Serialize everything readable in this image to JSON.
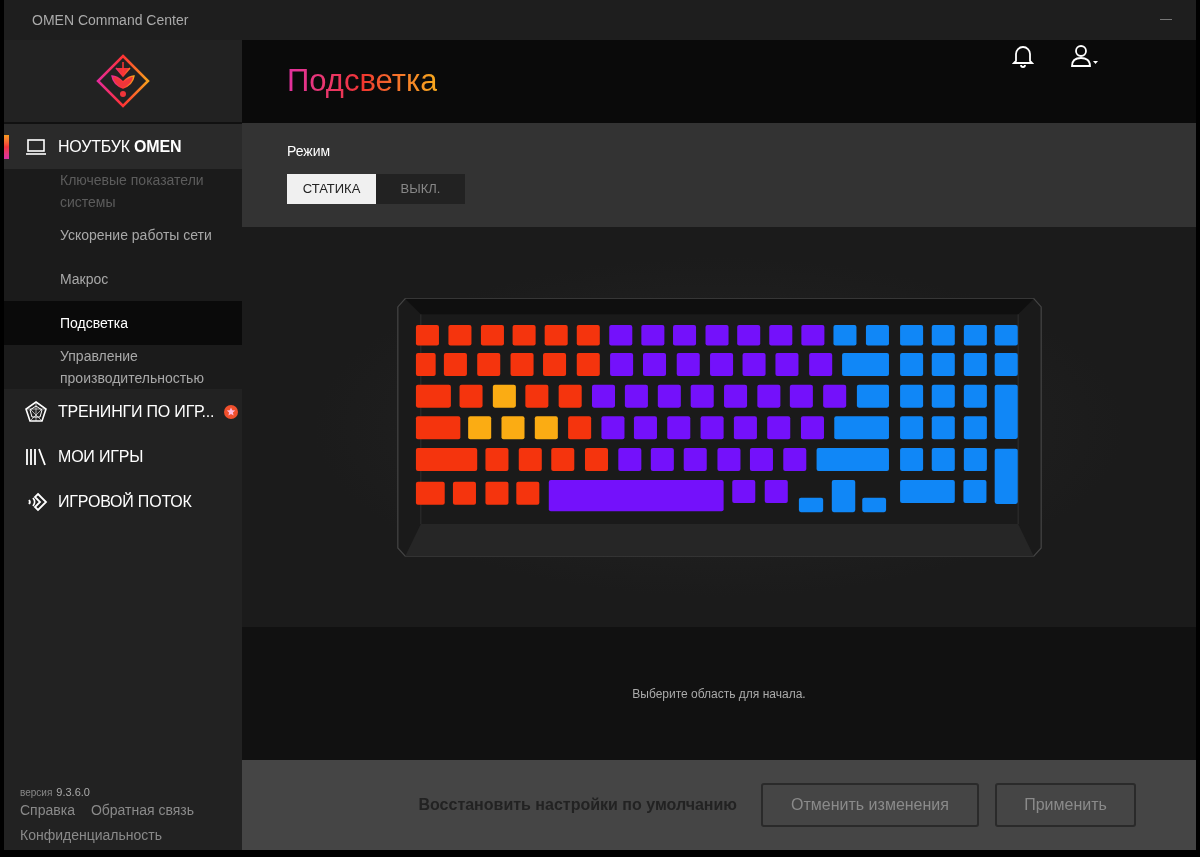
{
  "window": {
    "title": "OMEN Command Center"
  },
  "sidebar": {
    "items": [
      {
        "kind": "laptop",
        "label": "НОУТБУК **OMEN**",
        "selected": true,
        "badge": false,
        "children": [
          {
            "label": "Ключевые показатели системы",
            "selected": false,
            "disabled": true
          },
          {
            "label": "Ускорение работы сети",
            "selected": false,
            "disabled": false
          },
          {
            "label": "Макрос",
            "selected": false,
            "disabled": false
          },
          {
            "label": "Подсветка",
            "selected": true,
            "disabled": false
          },
          {
            "label": "Управление производительностью",
            "selected": false,
            "disabled": false
          }
        ]
      },
      {
        "kind": "pentagon",
        "label": "ТРЕНИНГИ ПО ИГР...",
        "selected": false,
        "badge": true
      },
      {
        "kind": "library",
        "label": "МОИ ИГРЫ",
        "selected": false,
        "badge": false
      },
      {
        "kind": "stream",
        "label": "ИГРОВОЙ ПОТОК",
        "selected": false,
        "badge": false
      }
    ],
    "version_label": "версия",
    "version": "9.3.6.0",
    "links": [
      "Справка",
      "Обратная связь",
      "Конфиденциальность"
    ]
  },
  "header": {
    "title": "Подсветка"
  },
  "mode": {
    "label": "Режим",
    "options": [
      {
        "label": "СТАТИКА",
        "selected": true
      },
      {
        "label": "ВЫКЛ.",
        "selected": false
      }
    ]
  },
  "keyboard": {
    "zones": [
      {
        "color": "#f5340d"
      },
      {
        "color": "#fbac13"
      },
      {
        "color": "#7411fb"
      },
      {
        "color": "#1087f7"
      }
    ]
  },
  "hint": "Выберите область для начала.",
  "footer": {
    "reset": "Восстановить настройки по умолчанию",
    "buttons": [
      {
        "label": "Отменить изменения",
        "disabled": true
      },
      {
        "label": "Применить",
        "disabled": true
      }
    ]
  }
}
